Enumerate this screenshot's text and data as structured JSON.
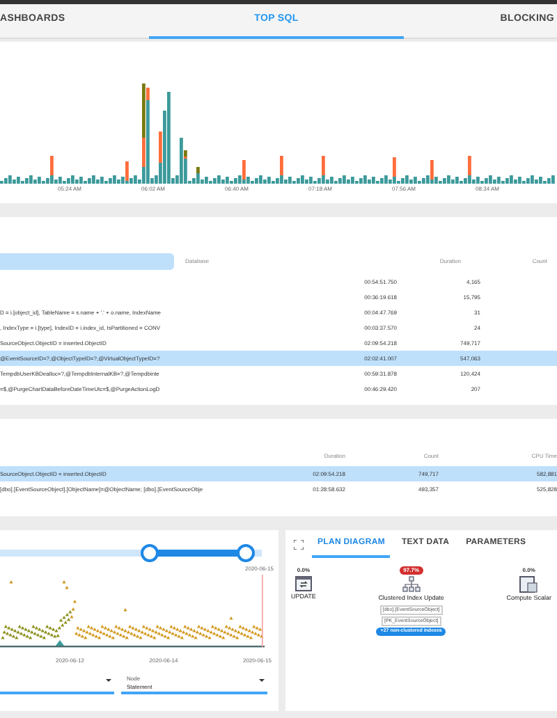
{
  "tabs": [
    {
      "label": "ASHBOARDS",
      "selected": false
    },
    {
      "label": "TOP SQL",
      "selected": true
    },
    {
      "label": "BLOCKING",
      "selected": false
    }
  ],
  "timeline": {
    "x_labels": [
      "05:24 AM",
      "06:02 AM",
      "06:40 AM",
      "07:18 AM",
      "07:56 AM",
      "08:34 AM"
    ]
  },
  "statements": {
    "columns": [
      "Database",
      "Duration",
      "Count"
    ],
    "rows": [
      {
        "duration": "00:54:51.750",
        "count": "4,165",
        "selected": false
      },
      {
        "duration": "00:36:19.618",
        "count": "15,795",
        "selected": false
      },
      {
        "text": "D = i.[object_id], TableName = s.name + '.' + o.name, IndexName",
        "duration": "00:04:47.769",
        "count": "31",
        "selected": false
      },
      {
        "text": ", IndexType = i.[type], IndexID = i.index_id, IsPartitioned = CONV",
        "duration": "00:03:37.570",
        "count": "24",
        "selected": false
      },
      {
        "text": "SourceObject.ObjectID = inserted.ObjectID",
        "duration": "02:09:54.218",
        "count": "749,717",
        "selected": false
      },
      {
        "text": "@EventSourceID=?,@ObjectTypeID=?,@VirtualObjectTypeID=?",
        "duration": "02:02:41.007",
        "count": "547,063",
        "selected": true
      },
      {
        "text": "TempdbUserKBDealloc=?,@TempdbInternalKB=?,@Tempdbinte",
        "duration": "00:59:31.878",
        "count": "120,424",
        "selected": false
      },
      {
        "text": "=$,@PurgeChartDataBeforeDateTimeUtc=$,@PurgeActionLogD",
        "duration": "00:46:29.420",
        "count": "207",
        "selected": false
      }
    ]
  },
  "history": {
    "columns": [
      "Duration",
      "Count",
      "CPU Time"
    ],
    "rows": [
      {
        "text": "SourceObject.ObjectID = inserted.ObjectID",
        "duration": "02:09:54.218",
        "count": "749,717",
        "cpu": "582,881",
        "selected": true
      },
      {
        "text": "[dbo].[EventSourceObject].[ObjectName]=@ObjectName; [dbo].[EventSourceObje",
        "duration": "01:28:58.632",
        "count": "493,357",
        "cpu": "525,828",
        "selected": false
      }
    ]
  },
  "range": {
    "handles": [
      {
        "level": 0.57
      },
      {
        "level": 0.94
      }
    ],
    "end_label": "2020-06-15",
    "x_labels": [
      "2020-06-12",
      "2020-06-14",
      "2020-06-15"
    ]
  },
  "filters": [
    {
      "kind": "dropdown"
    },
    {
      "kind": "dropdown",
      "label": "Node",
      "value": "Statement"
    }
  ],
  "plan": {
    "tabs": [
      {
        "label": "PLAN DIAGRAM",
        "selected": true
      },
      {
        "label": "TEXT DATA",
        "selected": false
      },
      {
        "label": "PARAMETERS",
        "selected": false
      }
    ],
    "nodes": [
      {
        "kind": "update",
        "cost": "0.0%",
        "high": false,
        "name": "UPDATE"
      },
      {
        "kind": "index",
        "cost": "97.7%",
        "high": true,
        "name": "Clustered Index Update",
        "details": [
          "[dbo].[EventSourceObject]",
          "[PK_EventSourceObject]"
        ],
        "pill": "+27 non-clustered indexes"
      },
      {
        "kind": "scalar",
        "cost": "0.0%",
        "high": false,
        "name": "Compute Scalar"
      }
    ]
  }
}
